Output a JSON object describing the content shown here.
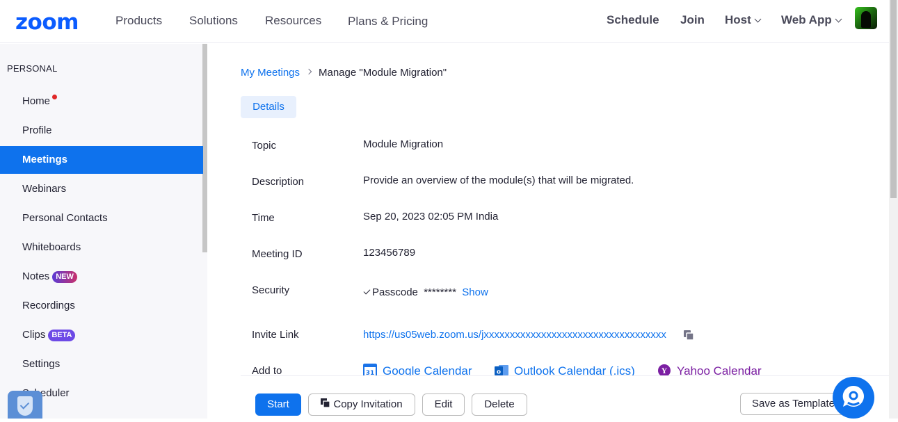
{
  "nav": {
    "logo": "zoom",
    "links": [
      "Products",
      "Solutions",
      "Resources",
      "Plans & Pricing"
    ],
    "right": [
      "Schedule",
      "Join",
      "Host",
      "Web App"
    ]
  },
  "sidebar": {
    "header": "PERSONAL",
    "items": [
      {
        "label": "Home"
      },
      {
        "label": "Profile"
      },
      {
        "label": "Meetings",
        "active": true
      },
      {
        "label": "Webinars"
      },
      {
        "label": "Personal Contacts"
      },
      {
        "label": "Whiteboards"
      },
      {
        "label": "Notes",
        "badge": "NEW"
      },
      {
        "label": "Recordings"
      },
      {
        "label": "Clips",
        "badge": "BETA"
      },
      {
        "label": "Settings"
      },
      {
        "label": "Scheduler"
      }
    ]
  },
  "breadcrumb": {
    "parent": "My Meetings",
    "current": "Manage \"Module Migration\""
  },
  "tabs": {
    "details": "Details"
  },
  "meeting": {
    "topic_label": "Topic",
    "topic": "Module Migration",
    "description_label": "Description",
    "description": "Provide an overview of the module(s) that will be migrated.",
    "time_label": "Time",
    "time": "Sep 20, 2023 02:05 PM India",
    "id_label": "Meeting ID",
    "id": "123456789",
    "security_label": "Security",
    "passcode_label": "Passcode",
    "passcode_masked": "********",
    "show_label": "Show",
    "invite_label": "Invite Link",
    "invite_link": "https://us05web.zoom.us/jxxxxxxxxxxxxxxxxxxxxxxxxxxxxxxxxxxx",
    "add_to_label": "Add to",
    "calendars": [
      "Google Calendar",
      "Outlook Calendar (.ics)",
      "Yahoo Calendar"
    ]
  },
  "actions": {
    "start": "Start",
    "copy_invitation": "Copy Invitation",
    "edit": "Edit",
    "delete": "Delete",
    "save_template": "Save as Template"
  },
  "colors": {
    "accent": "#0e72ed",
    "brand": "#0b5cff",
    "yahoo": "#7b1fa2"
  }
}
